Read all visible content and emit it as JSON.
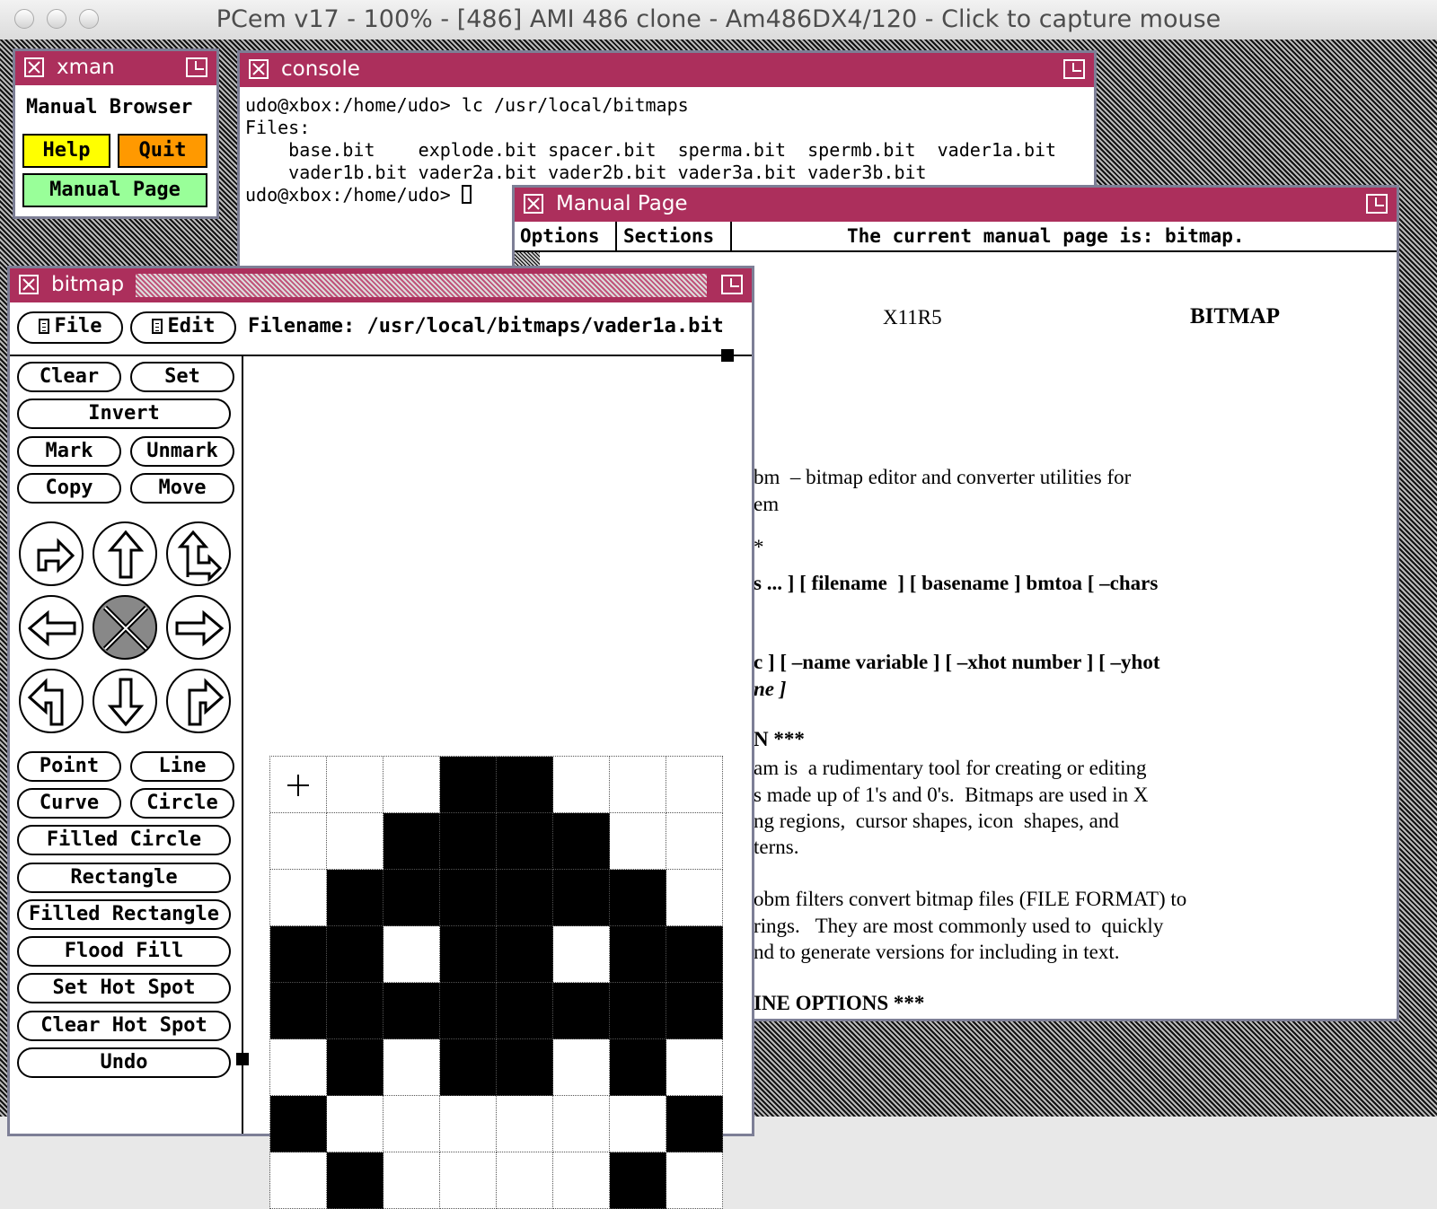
{
  "host_window": {
    "title": "PCem v17 - 100% - [486] AMI 486 clone - Am486DX4/120 - Click to capture mouse"
  },
  "xman": {
    "title": "xman",
    "heading": "Manual Browser",
    "help_label": "Help",
    "quit_label": "Quit",
    "manual_page_label": "Manual Page",
    "colors": {
      "help": "#ffff00",
      "quit": "#ff9900",
      "manual_page": "#99ff99"
    }
  },
  "console": {
    "title": "console",
    "lines": [
      "udo@xbox:/home/udo> lc /usr/local/bitmaps",
      "Files:",
      "    base.bit    explode.bit spacer.bit  sperma.bit  spermb.bit  vader1a.bit",
      "    vader1b.bit vader2a.bit vader2b.bit vader3a.bit vader3b.bit"
    ],
    "prompt": "udo@xbox:/home/udo> "
  },
  "manual_page": {
    "title": "Manual Page",
    "menu_options": "Options",
    "menu_sections": "Sections",
    "status": "The current manual page is: bitmap.",
    "header_left": "X11R5",
    "header_right": "BITMAP",
    "lines": [
      "bm  – bitmap editor and converter utilities for",
      "em",
      "*",
      "s ... ] [ filename  ] [ basename ] bmtoa [ –chars",
      "c ] [ –name variable ] [ –xhot number ] [ –yhot",
      "ne ]",
      "N ***",
      "am is  a rudimentary tool for creating or editing",
      "s made up of 1's and 0's.  Bitmaps are used in X",
      "ng regions,  cursor shapes, icon  shapes, and",
      "terns.",
      "obm filters convert bitmap files (FILE FORMAT) to",
      "rings.   They are most commonly used to  quickly",
      "nd to generate versions for including in text.",
      "INE OPTIONS ***"
    ]
  },
  "bitmap": {
    "title": "bitmap",
    "file_menu": "File",
    "edit_menu": "Edit",
    "filename": "Filename: /usr/local/bitmaps/vader1a.bit",
    "buttons": {
      "clear": "Clear",
      "set": "Set",
      "invert": "Invert",
      "mark": "Mark",
      "unmark": "Unmark",
      "copy": "Copy",
      "move": "Move",
      "point": "Point",
      "line": "Line",
      "curve": "Curve",
      "circle": "Circle",
      "filled_circle": "Filled Circle",
      "rectangle": "Rectangle",
      "filled_rectangle": "Filled Rectangle",
      "flood_fill": "Flood Fill",
      "set_hot_spot": "Set Hot Spot",
      "clear_hot_spot": "Clear Hot Spot",
      "undo": "Undo"
    },
    "arrow_icons": [
      "flip-horizontal-icon",
      "up-arrow-icon",
      "rotate-icon",
      "left-arrow-icon",
      "fold-icon",
      "right-arrow-icon",
      "rotate-left-icon",
      "down-arrow-icon",
      "rotate-right-icon"
    ],
    "grid": [
      [
        0,
        0,
        0,
        1,
        1,
        0,
        0,
        0
      ],
      [
        0,
        0,
        1,
        1,
        1,
        1,
        0,
        0
      ],
      [
        0,
        1,
        1,
        1,
        1,
        1,
        1,
        0
      ],
      [
        1,
        1,
        0,
        1,
        1,
        0,
        1,
        1
      ],
      [
        1,
        1,
        1,
        1,
        1,
        1,
        1,
        1
      ],
      [
        0,
        1,
        0,
        1,
        1,
        0,
        1,
        0
      ],
      [
        1,
        0,
        0,
        0,
        0,
        0,
        0,
        1
      ],
      [
        0,
        1,
        0,
        0,
        0,
        0,
        1,
        0
      ]
    ]
  }
}
